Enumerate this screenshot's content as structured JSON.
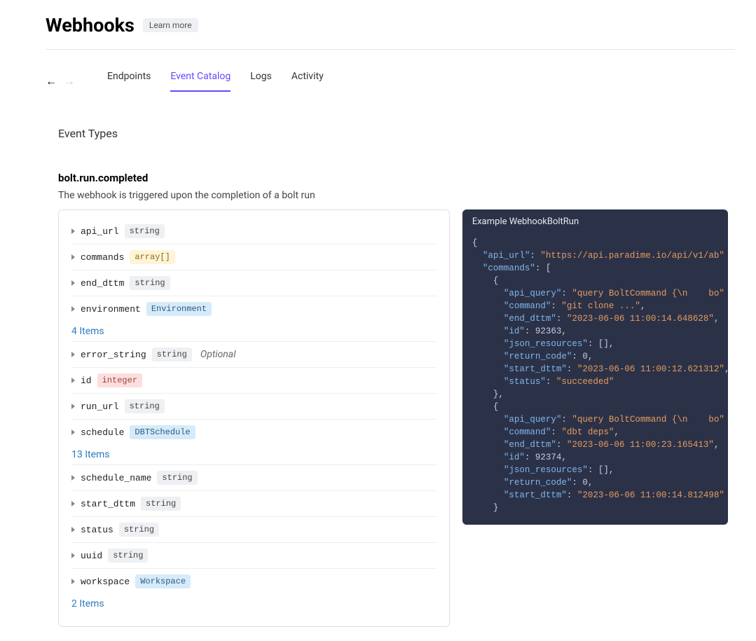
{
  "header": {
    "title": "Webhooks",
    "learn_more": "Learn more"
  },
  "tabs": {
    "endpoints": "Endpoints",
    "event_catalog": "Event Catalog",
    "logs": "Logs",
    "activity": "Activity"
  },
  "section": {
    "title": "Event Types"
  },
  "event": {
    "name": "bolt.run.completed",
    "desc": "The webhook is triggered upon the completion of a bolt run"
  },
  "type_labels": {
    "string": "string",
    "array": "array[]",
    "environment": "Environment",
    "integer": "integer",
    "dbtschedule": "DBTSchedule",
    "workspace": "Workspace"
  },
  "optional_label": "Optional",
  "fields": {
    "api_url": "api_url",
    "commands": "commands",
    "end_dttm": "end_dttm",
    "environment": "environment",
    "items4": "4 Items",
    "error_string": "error_string",
    "id": "id",
    "run_url": "run_url",
    "schedule": "schedule",
    "items13": "13 Items",
    "schedule_name": "schedule_name",
    "start_dttm": "start_dttm",
    "status": "status",
    "uuid": "uuid",
    "workspace": "workspace",
    "items2": "2 Items"
  },
  "example": {
    "title": "Example WebhookBoltRun",
    "json": {
      "api_url": "https://api.paradime.io/api/v1/ab",
      "commands": [
        {
          "api_query": "query BoltCommand {\\n    bo",
          "command": "git clone ...",
          "end_dttm": "2023-06-06 11:00:14.648628",
          "id": 92363,
          "json_resources": "[]",
          "return_code": 0,
          "start_dttm": "2023-06-06 11:00:12.621312",
          "status": "succeeded"
        },
        {
          "api_query": "query BoltCommand {\\n    bo",
          "command": "dbt deps",
          "end_dttm": "2023-06-06 11:00:23.165413",
          "id": 92374,
          "json_resources": "[]",
          "return_code": 0,
          "start_dttm": "2023-06-06 11:00:14.812498"
        }
      ]
    }
  }
}
